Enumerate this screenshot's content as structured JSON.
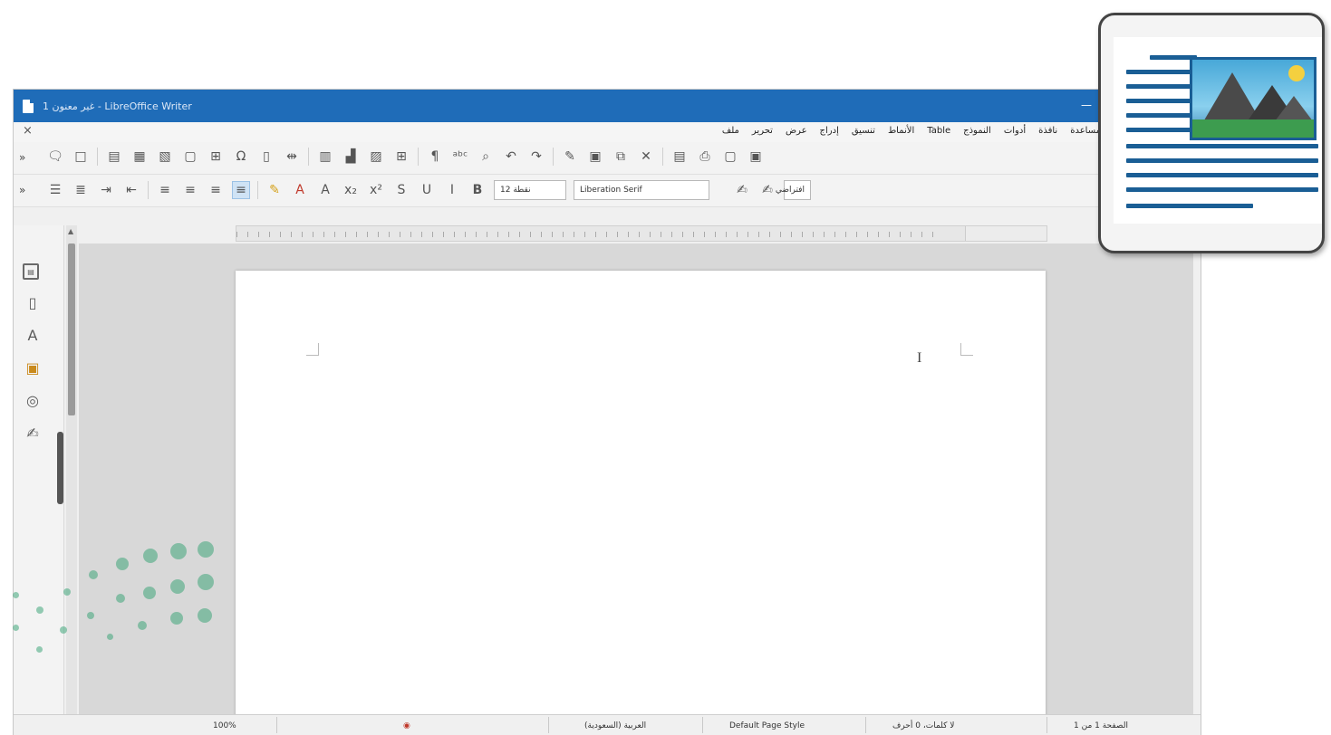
{
  "window": {
    "title": "غير معنون 1 - LibreOffice Writer",
    "minimize_glyph": "—",
    "close_doc_glyph": "×"
  },
  "menu": {
    "items": [
      "ملف",
      "تحرير",
      "عرض",
      "إدراج",
      "تنسيق",
      "الأنماط",
      "Table",
      "النموذج",
      "أدوات",
      "نافذة",
      "مساعدة"
    ]
  },
  "toolbar_formatting": {
    "font_name": "Liberation Serif",
    "font_size": "12 نقطة",
    "paragraph_style": "افتراضي"
  },
  "statusbar": {
    "page": "الصفحة 1 من 1",
    "word_count": "لا كلمات، 0 أحرف",
    "page_style": "Default Page Style",
    "language": "العربية (السعودية)",
    "zoom": "100%"
  },
  "colors": {
    "titlebar": "#1f6cb8",
    "accent_green": "#3fa57a",
    "inset_blue": "#1a5e95"
  },
  "icons": {
    "sidebar": [
      "properties-icon",
      "page-icon",
      "styles-icon",
      "gallery-icon",
      "navigator-icon",
      "manage-changes-icon"
    ]
  }
}
